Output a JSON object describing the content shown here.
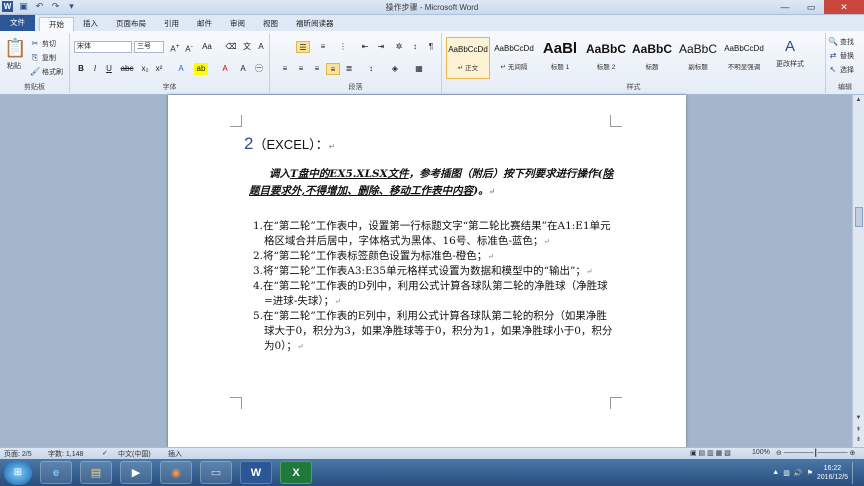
{
  "window": {
    "title": "操作步骤 - Microsoft Word",
    "controls": [
      "—",
      "▭",
      "✕"
    ]
  },
  "tabs": [
    "文件",
    "开始",
    "插入",
    "页面布局",
    "引用",
    "邮件",
    "审阅",
    "视图",
    "福昕阅读器"
  ],
  "ribbon": {
    "clipboard": {
      "paste": "粘贴",
      "cut": "剪切",
      "copy": "复制",
      "format_painter": "格式刷",
      "label": "剪贴板"
    },
    "font": {
      "name": "宋体",
      "size": "三号",
      "label": "字体",
      "bold": "B",
      "italic": "I",
      "underline": "U"
    },
    "paragraph": {
      "label": "段落"
    },
    "styles": {
      "label": "样式",
      "items": [
        {
          "sample": "AaBbCcDd",
          "name": "↵ 正文",
          "size": "8px",
          "weight": "normal"
        },
        {
          "sample": "AaBbCcDd",
          "name": "↵ 无间隔",
          "size": "8px",
          "weight": "normal"
        },
        {
          "sample": "AaBl",
          "name": "标题 1",
          "size": "15px",
          "weight": "bold"
        },
        {
          "sample": "AaBbC",
          "name": "标题 2",
          "size": "12px",
          "weight": "bold"
        },
        {
          "sample": "AaBbC",
          "name": "标题",
          "size": "12px",
          "weight": "bold"
        },
        {
          "sample": "AaBbC",
          "name": "副标题",
          "size": "12px",
          "weight": "normal"
        },
        {
          "sample": "AaBbCcDd",
          "name": "不明显强调",
          "size": "8px",
          "weight": "normal"
        }
      ],
      "change_styles": "更改样式"
    },
    "editing": {
      "find": "查找",
      "replace": "替换",
      "select": "选择",
      "label": "编辑"
    }
  },
  "document": {
    "heading_num": "2",
    "heading_text": "（EXCEL）：",
    "intro_a": "调入",
    "intro_b": "T盘中的EX5.XLSX文件",
    "intro_c": "，参考插图（附后）按下列要求进行操作(",
    "intro_d": "除题目要求外,不得增加、删除、移动工作表中内容",
    "intro_e": ")。",
    "items": [
      "1.在“第二轮”工作表中，设置第一行标题文字“第二轮比赛结果”在A1:E1单元格区域合并后居中，字体格式为黑体、16号、标准色-蓝色；",
      "2.将“第二轮”工作表标签颜色设置为标准色-橙色；",
      "3.将“第二轮”工作表A3:E35单元格样式设置为数据和模型中的“输出”；",
      "4.在“第二轮”工作表的D列中，利用公式计算各球队第二轮的净胜球（净胜球=进球-失球）；",
      "5.在“第二轮”工作表的E列中，利用公式计算各球队第二轮的积分（如果净胜球大于0，积分为3，如果净胜球等于0，积分为1，如果净胜球小于0，积分为0）；"
    ]
  },
  "status": {
    "page": "页面: 2/5",
    "words": "字数: 1,148",
    "lang": "中文(中国)",
    "mode": "插入",
    "zoom": "100%"
  },
  "taskbar": {
    "word_label": "W",
    "excel_label": "X",
    "time": "16:22",
    "date": "2016/12/5"
  }
}
